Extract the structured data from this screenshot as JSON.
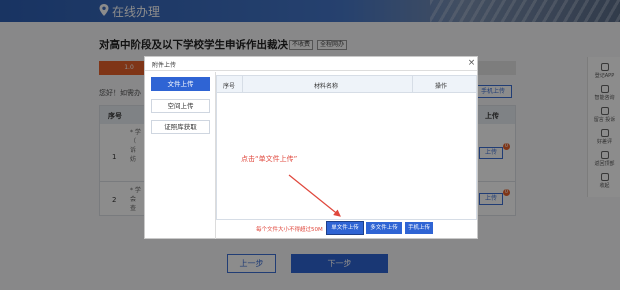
{
  "header": {
    "title": "在线办理",
    "icon": "location-pin-icon"
  },
  "page": {
    "heading": "对高中阶段及以下学校学生申诉作出裁决",
    "tags": [
      "不收费",
      "全程网办"
    ],
    "step_active_label": "1.0",
    "greeting": "您好！如需办",
    "mobile_upload_label": "手机上传"
  },
  "bg_table": {
    "col_index": "序号",
    "col_upload": "上传",
    "rows": [
      {
        "index": "1",
        "snippet": "* 学\n（\n诉\n妨"
      },
      {
        "index": "2",
        "snippet": "* 学\n会\n查"
      }
    ],
    "upload_label": "上传",
    "badges": [
      "0",
      "0"
    ]
  },
  "footer": {
    "prev_label": "上一步",
    "next_label": "下一步"
  },
  "side_rail": [
    {
      "label": "登记APP",
      "icon": "phone-icon"
    },
    {
      "label": "智能咨询",
      "icon": "chat-icon"
    },
    {
      "label": "留言 投诉",
      "icon": "message-icon"
    },
    {
      "label": "好差评",
      "icon": "rating-icon"
    },
    {
      "label": "返回顶部",
      "icon": "arrow-up-icon"
    },
    {
      "label": "收起",
      "icon": "collapse-icon"
    }
  ],
  "modal": {
    "title": "附件上传",
    "close": "×",
    "tabs": [
      "文件上传",
      "空间上传",
      "证照库获取"
    ],
    "active_tab": 0,
    "columns": [
      "序号",
      "材料名称",
      "操作"
    ],
    "hint": "点击“单文件上传”",
    "size_note": "每个文件大小不得超过50M",
    "buttons": [
      "单文件上传",
      "多文件上传",
      "手机上传"
    ]
  },
  "colors": {
    "primary": "#2f64d4",
    "accent": "#e8622a",
    "hint": "#e0473c"
  }
}
